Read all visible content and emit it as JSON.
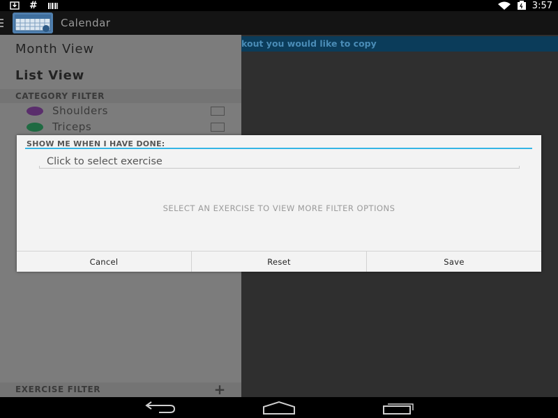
{
  "status_bar": {
    "time": "3:57",
    "left_icons": [
      "download-icon",
      "hash-icon",
      "barcode-icon"
    ],
    "right_icons": [
      "wifi-icon",
      "battery-icon"
    ],
    "hash_glyph": "#"
  },
  "action_bar": {
    "title": "Calendar",
    "menu_icon": "drawer-menu-icon",
    "app_icon": "calendar-app-icon"
  },
  "background": {
    "hint_text": "kout you would like to copy"
  },
  "drawer": {
    "nav_items": [
      "Month View",
      "List View"
    ],
    "category_header": "CATEGORY FILTER",
    "categories": [
      {
        "label": "Shoulders",
        "color": "#5a2e6c"
      },
      {
        "label": "Triceps",
        "color": "#1f6a42"
      }
    ],
    "exercise_header": "EXERCISE FILTER",
    "add_glyph": "+"
  },
  "dialog": {
    "title": "SHOW ME WHEN I HAVE DONE:",
    "input_placeholder": "Click to select exercise",
    "hint": "SELECT AN EXERCISE TO VIEW MORE FILTER OPTIONS",
    "buttons": [
      "Cancel",
      "Reset",
      "Save"
    ]
  },
  "navigation_bar": {
    "icons": [
      "back-icon",
      "home-icon",
      "recent-apps-icon"
    ]
  },
  "colors": {
    "accent": "#33b5e5",
    "drawer_bg": "#7c7c7c",
    "dialog_bg": "#f3f3f3",
    "content_bg": "#2f2f2f"
  }
}
